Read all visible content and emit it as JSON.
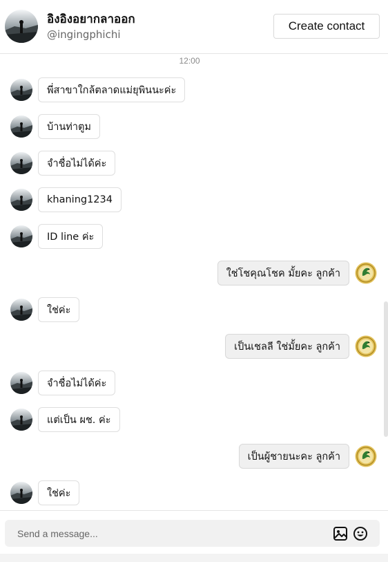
{
  "header": {
    "name": "อิงอิงอยากลาออก",
    "handle": "@ingingphichi",
    "create_contact_label": "Create contact"
  },
  "chat": {
    "timestamp": "12:00",
    "messages": [
      {
        "side": "in",
        "text": "พี่สาขาใกล้ตลาดแม่ยุพินนะค่ะ"
      },
      {
        "side": "in",
        "text": "บ้านท่าตูม"
      },
      {
        "side": "in",
        "text": "จำชื่อไม่ได้ค่ะ"
      },
      {
        "side": "in",
        "text": "khaning1234"
      },
      {
        "side": "in",
        "text": "ID line ค่ะ"
      },
      {
        "side": "out",
        "text": "ใช่โชคุณโชค มั้ยคะ ลูกค้า"
      },
      {
        "side": "in",
        "text": "ใช่ค่ะ"
      },
      {
        "side": "out",
        "text": "เป็นเชลลี ใช่มั้ยคะ ลูกค้า"
      },
      {
        "side": "in",
        "text": "จำชื่อไม่ได้ค่ะ"
      },
      {
        "side": "in",
        "text": "แต่เป็น ผช. ค่ะ"
      },
      {
        "side": "out",
        "text": "เป็นผู้ชายนะคะ ลูกค้า"
      },
      {
        "side": "in",
        "text": "ใช่ค่ะ"
      }
    ]
  },
  "composer": {
    "placeholder": "Send a message..."
  },
  "icons": {
    "image": "image-icon",
    "emoji": "emoji-icon"
  },
  "colors": {
    "outgoing_bubble": "#f0f0f0",
    "incoming_bubble": "#ffffff",
    "border": "#dedede",
    "logo_gold": "#c9a227",
    "logo_green": "#2f7d32"
  }
}
